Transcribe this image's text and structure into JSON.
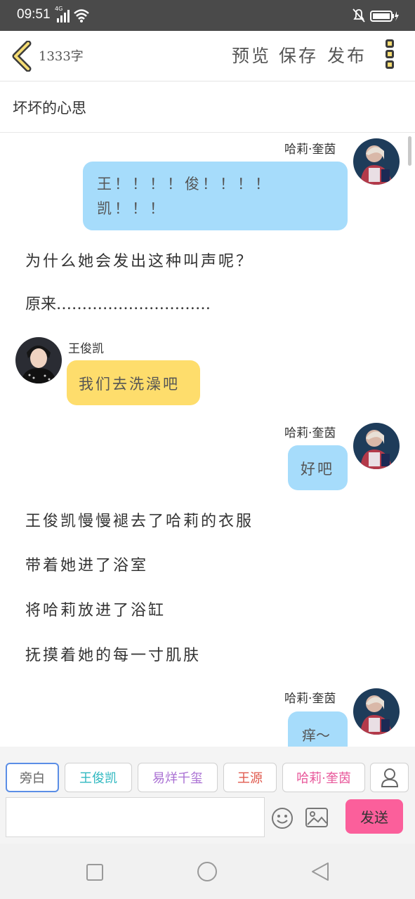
{
  "status_bar": {
    "time": "09:51",
    "network": "4G"
  },
  "toolbar": {
    "word_count": "1333字",
    "preview_label": "预览",
    "save_label": "保存",
    "publish_label": "发布"
  },
  "story_title": "坏坏的心思",
  "messages": [
    {
      "type": "chat",
      "side": "right",
      "speaker": "哈莉·奎茵",
      "lines": [
        "王！！！！俊！！！！",
        "凯！！！"
      ]
    },
    {
      "type": "narration",
      "text": "为什么她会发出这种叫声呢？"
    },
    {
      "type": "narration",
      "text": "原来…………………………"
    },
    {
      "type": "chat",
      "side": "left",
      "speaker": "王俊凯",
      "lines": [
        "我们去洗澡吧"
      ]
    },
    {
      "type": "chat",
      "side": "right",
      "speaker": "哈莉·奎茵",
      "lines": [
        "好吧"
      ]
    },
    {
      "type": "narration",
      "text": "王俊凯慢慢褪去了哈莉的衣服"
    },
    {
      "type": "narration",
      "text": "带着她进了浴室"
    },
    {
      "type": "narration",
      "text": "将哈莉放进了浴缸"
    },
    {
      "type": "narration",
      "text": "抚摸着她的每一寸肌肤"
    },
    {
      "type": "chat",
      "side": "right",
      "speaker": "哈莉·奎茵",
      "lines": [
        "痒～"
      ]
    }
  ],
  "roles": [
    {
      "label": "旁白",
      "color": "#666666",
      "selected": true
    },
    {
      "label": "王俊凯",
      "color": "#2fb8c0"
    },
    {
      "label": "易烊千玺",
      "color": "#a96fd3"
    },
    {
      "label": "王源",
      "color": "#e05a4e"
    },
    {
      "label": "哈莉·奎茵",
      "color": "#e8579a"
    }
  ],
  "icons": {
    "add_role": "person-icon",
    "emoji": "emoji-icon",
    "image": "image-icon"
  },
  "send_label": "发送",
  "colors": {
    "send": "#fb5f9b",
    "bubble_blue": "#a6dcfb",
    "bubble_yellow": "#fedd6c",
    "back_arrow": "#f5dc73"
  }
}
